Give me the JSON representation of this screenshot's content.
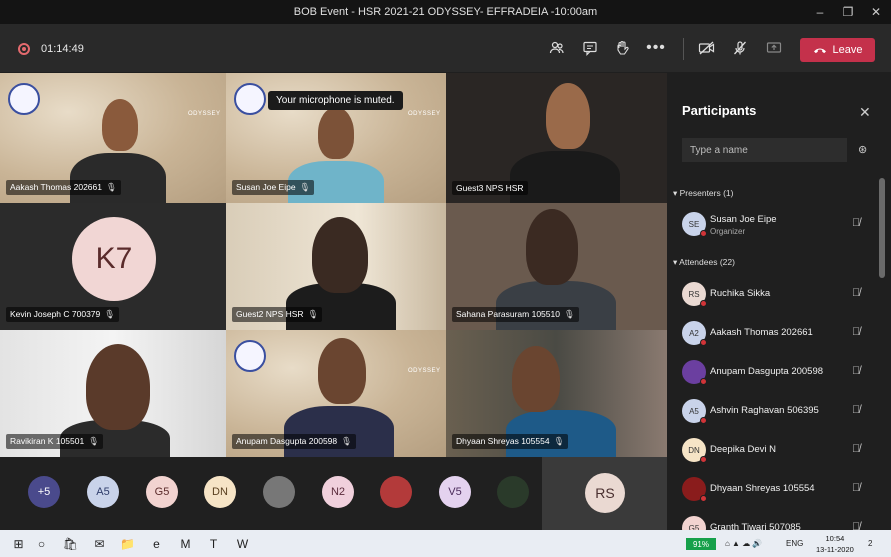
{
  "window": {
    "title": "BOB Event - HSR 2021-21 ODYSSEY- EFFRADEIA -10:00am",
    "minimize": "–",
    "maximize": "❐",
    "close": "✕"
  },
  "toolbar": {
    "timer": "01:14:49",
    "leave_label": "Leave"
  },
  "toast": "Your microphone is muted.",
  "tiles": [
    {
      "name": "Aakash Thomas 202661"
    },
    {
      "name": "Susan Joe Eipe"
    },
    {
      "name": "Guest3 NPS HSR"
    },
    {
      "name": "Kevin Joseph C 700379",
      "initials": "K7"
    },
    {
      "name": "Guest2 NPS HSR"
    },
    {
      "name": "Sahana Parasuram 105510"
    },
    {
      "name": "Ravikiran K 105501"
    },
    {
      "name": "Anupam Dasgupta 200598"
    },
    {
      "name": "Dhyaan Shreyas 105554"
    }
  ],
  "odyssey_label": "ODYSSEY",
  "strip": {
    "avatars": [
      {
        "text": "+5",
        "bg": "#4a4a8c",
        "fg": "#ffffff"
      },
      {
        "text": "A5",
        "bg": "#c9d3ea",
        "fg": "#2f3d6b"
      },
      {
        "text": "G5",
        "bg": "#f2d3d0",
        "fg": "#5b2b2b"
      },
      {
        "text": "DN",
        "bg": "#f6e4c6",
        "fg": "#5a4020"
      },
      {
        "text": "",
        "bg": "#777777",
        "fg": "#ffffff"
      },
      {
        "text": "N2",
        "bg": "#f0d0dc",
        "fg": "#5b2b3c"
      },
      {
        "text": "",
        "bg": "#b33a3a",
        "fg": "#ffffff"
      },
      {
        "text": "V5",
        "bg": "#e4d2ef",
        "fg": "#4b2b5b"
      },
      {
        "text": "",
        "bg": "#2a3a2a",
        "fg": "#ffffff"
      }
    ],
    "rs": "RS"
  },
  "panel": {
    "title": "Participants",
    "search_placeholder": "Type a name",
    "presenters_label": "Presenters (1)",
    "attendees_label": "Attendees (22)",
    "presenters": [
      {
        "initials": "SE",
        "name": "Susan Joe Eipe",
        "role": "Organizer",
        "bg": "#c9d3ea"
      }
    ],
    "attendees": [
      {
        "initials": "RS",
        "name": "Ruchika Sikka",
        "bg": "#ead9d2"
      },
      {
        "initials": "A2",
        "name": "Aakash Thomas 202661",
        "bg": "#c9d3ea"
      },
      {
        "initials": "",
        "name": "Anupam Dasgupta 200598",
        "bg": "#6b3fa0"
      },
      {
        "initials": "A5",
        "name": "Ashvin Raghavan 506395",
        "bg": "#c9d3ea"
      },
      {
        "initials": "DN",
        "name": "Deepika Devi N",
        "bg": "#f6e4c6"
      },
      {
        "initials": "",
        "name": "Dhyaan Shreyas 105554",
        "bg": "#8a1c1c"
      },
      {
        "initials": "G5",
        "name": "Granth Tiwari 507085",
        "bg": "#f2d3d0"
      }
    ]
  },
  "taskbar": {
    "battery": "91%",
    "lang": "ENG",
    "time": "10:54",
    "date": "13-11-2020",
    "notif": "2"
  },
  "colors": {
    "leave": "#c4314b",
    "accent": "#6264a7",
    "battery": "#16a04a"
  }
}
